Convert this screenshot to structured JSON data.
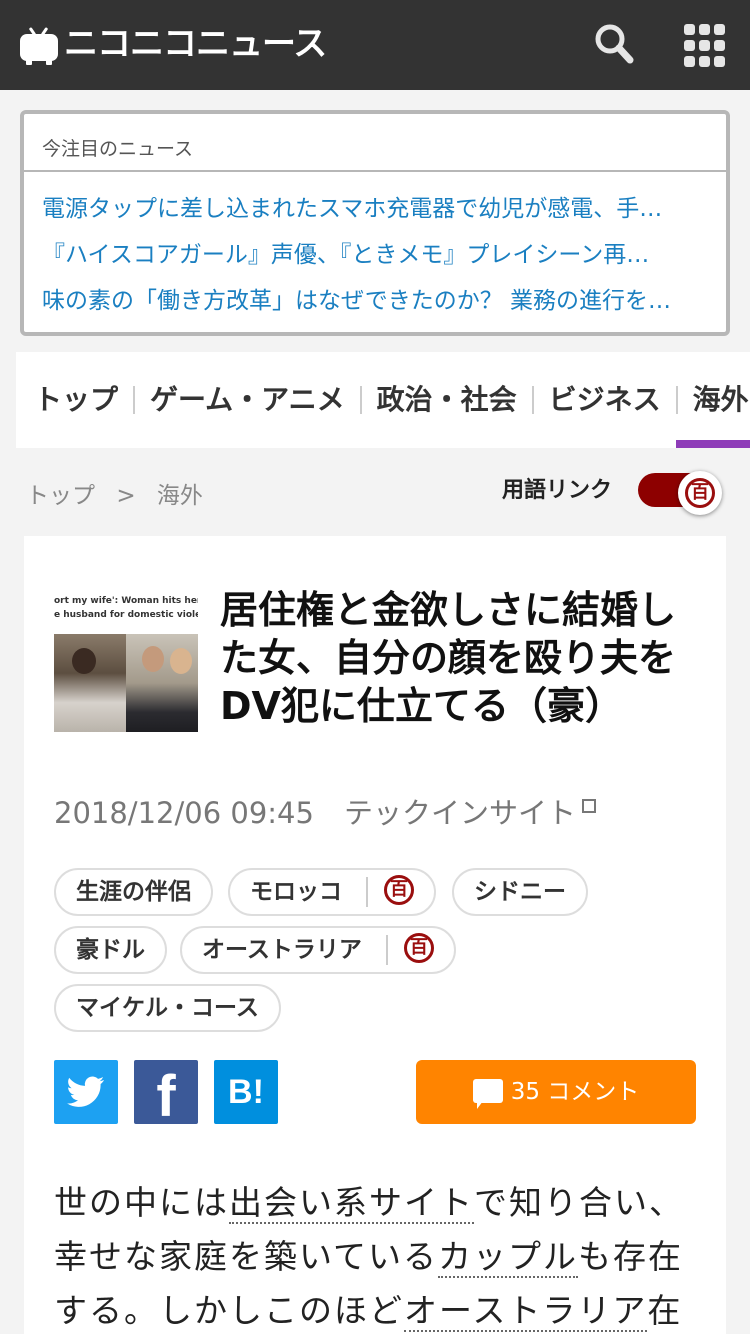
{
  "header": {
    "logo_text": "ニコニコニュース",
    "search_icon": "search-icon",
    "menu_icon": "grid-menu-icon"
  },
  "featured": {
    "heading": "今注目のニュース",
    "items": [
      "電源タップに差し込まれたスマホ充電器で幼児が感電、手…",
      "『ハイスコアガール』声優、『ときメモ』プレイシーン再…",
      "味の素の「働き方改革」はなぜできたのか？ 業務の進行を…"
    ],
    "link_color": "#1a7fc1"
  },
  "nav": {
    "categories": [
      "トップ",
      "ゲーム・アニメ",
      "政治・社会",
      "ビジネス",
      "海外"
    ],
    "active": "海外",
    "accent": "#8e3cb8"
  },
  "breadcrumb": {
    "items": [
      "トップ",
      ">",
      "海外"
    ]
  },
  "term_link": {
    "label": "用語リンク",
    "state": "on",
    "icon": "百"
  },
  "article": {
    "title": "居住権と金欲しさに結婚した女、自分の顔を殴り夫をDV犯に仕立てる（豪）",
    "date": "2018/12/06 09:45",
    "source": "テックインサイト",
    "thumb_caption_1": "ort my wife': Woman hits herself",
    "thumb_caption_2": "e husband for domestic violence",
    "tags": [
      "生涯の伴侶",
      "モロッコ",
      "シドニー",
      "豪ドル",
      "オーストラリア",
      "マイケル・コース"
    ],
    "share": {
      "twitter": "twitter-icon",
      "facebook": "f",
      "hatena": "B!"
    },
    "comment_count": "35",
    "comment_label": "コメント",
    "body_parts": [
      "世の中には",
      "出会い系サイト",
      "で知り合い、幸せな家庭を築いている",
      "カップル",
      "も存在する。しかしこのほど",
      "オーストラリア",
      "在"
    ]
  },
  "colors": {
    "header_bg": "#333333",
    "dic_red": "#9a0e0e",
    "comment": "#ff8400",
    "twitter": "#1da1f2",
    "facebook": "#3b5998",
    "hatena": "#008fde"
  }
}
